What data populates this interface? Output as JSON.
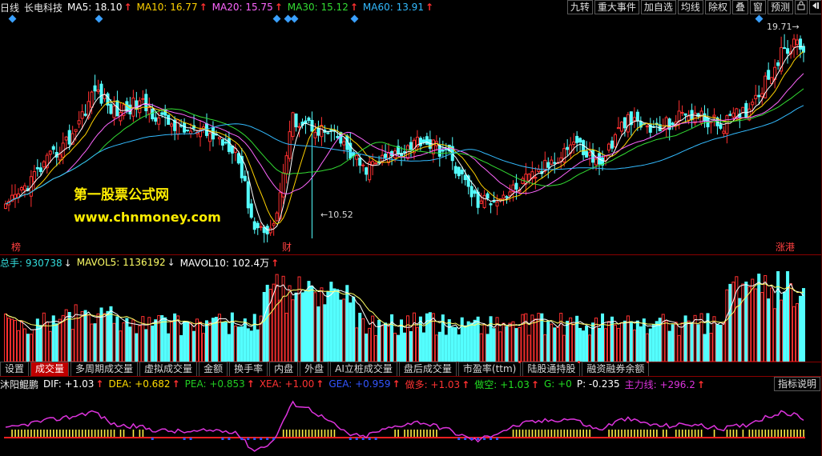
{
  "header": {
    "period": "日线",
    "stock_name": "长电科技",
    "ma": [
      {
        "label": "MA5:",
        "value": "18.10",
        "color": "#ffffff"
      },
      {
        "label": "MA10:",
        "value": "16.77",
        "color": "#ffd200"
      },
      {
        "label": "MA20:",
        "value": "15.75",
        "color": "#ff66ff"
      },
      {
        "label": "MA30:",
        "value": "15.12",
        "color": "#33dd33"
      },
      {
        "label": "MA60:",
        "value": "13.91",
        "color": "#33bbff"
      }
    ],
    "up_arrow": "↑",
    "down_arrow": "↓"
  },
  "toolbar": {
    "buttons": [
      "九转",
      "重大事件",
      "加自选",
      "均线",
      "除权",
      "叠",
      "窗",
      "预测"
    ],
    "icon_lock": "lock-icon",
    "icon_toggle": "collapse-icon"
  },
  "price_panel": {
    "high_label": "19.71",
    "low_label": "10.52",
    "markers": [
      "榜",
      "财",
      "涨港"
    ],
    "watermark_title": "第一股票公式网",
    "watermark_url": "www.chnmoney.com",
    "y_range": [
      9.8,
      20.6
    ]
  },
  "volume_panel": {
    "items": [
      {
        "label": "总手:",
        "value": "930738",
        "arrow": "↓",
        "color": "#33dddd"
      },
      {
        "label": "MAVOL5:",
        "value": "1136192",
        "arrow": "↓",
        "color": "#ffff66"
      },
      {
        "label": "MAVOL10:",
        "value": "102.4万",
        "arrow": "↑",
        "color": "#ffffff"
      }
    ]
  },
  "tabs": [
    {
      "label": "设置",
      "active": false,
      "dot": false
    },
    {
      "label": "成交量",
      "active": true,
      "dot": false
    },
    {
      "label": "多周期成交量",
      "active": false,
      "dot": false
    },
    {
      "label": "虚拟成交量",
      "active": false,
      "dot": false
    },
    {
      "label": "金额",
      "active": false,
      "dot": false
    },
    {
      "label": "换手率",
      "active": false,
      "dot": false
    },
    {
      "label": "内盘",
      "active": false,
      "dot": false
    },
    {
      "label": "外盘",
      "active": false,
      "dot": false
    },
    {
      "label": "AI立桩成交量",
      "active": false,
      "dot": false
    },
    {
      "label": "盘后成交量",
      "active": false,
      "dot": false
    },
    {
      "label": "市盈率(ttm)",
      "active": false,
      "dot": true
    },
    {
      "label": "陆股通持股",
      "active": false,
      "dot": true
    },
    {
      "label": "融资融券余额",
      "active": false,
      "dot": true
    }
  ],
  "indicator_panel": {
    "name": "沐阳鲲鹏",
    "items": [
      {
        "label": "DIF:",
        "value": "+1.03",
        "arrow": "↑",
        "color": "#ffffff"
      },
      {
        "label": "DEA:",
        "value": "+0.682",
        "arrow": "↑",
        "color": "#ffdd00"
      },
      {
        "label": "PEA:",
        "value": "+0.853",
        "arrow": "↑",
        "color": "#22cc22"
      },
      {
        "label": "XEA:",
        "value": "+1.00",
        "arrow": "↑",
        "color": "#ff3333"
      },
      {
        "label": "GEA:",
        "value": "+0.959",
        "arrow": "↑",
        "color": "#3355ff"
      },
      {
        "label": "做多:",
        "value": "+1.03",
        "arrow": "↑",
        "color": "#ff3333"
      },
      {
        "label": "做空:",
        "value": "+1.03",
        "arrow": "↑",
        "color": "#22dd22"
      },
      {
        "label": "G:",
        "value": "+0",
        "arrow": "",
        "color": "#22dd22"
      },
      {
        "label": "P:",
        "value": "-0.235",
        "arrow": "",
        "color": "#ffffff"
      },
      {
        "label": "主力线:",
        "value": "+296.2",
        "arrow": "↑",
        "color": "#dd33dd"
      }
    ],
    "help_label": "指标说明"
  },
  "colors": {
    "up": "#ff3030",
    "down": "#54ffff",
    "ma5": "#ffffff",
    "ma10": "#ffd200",
    "ma20": "#ff66ff",
    "ma30": "#33dd33",
    "ma60": "#33bbff",
    "separator": "#8b0000"
  }
}
